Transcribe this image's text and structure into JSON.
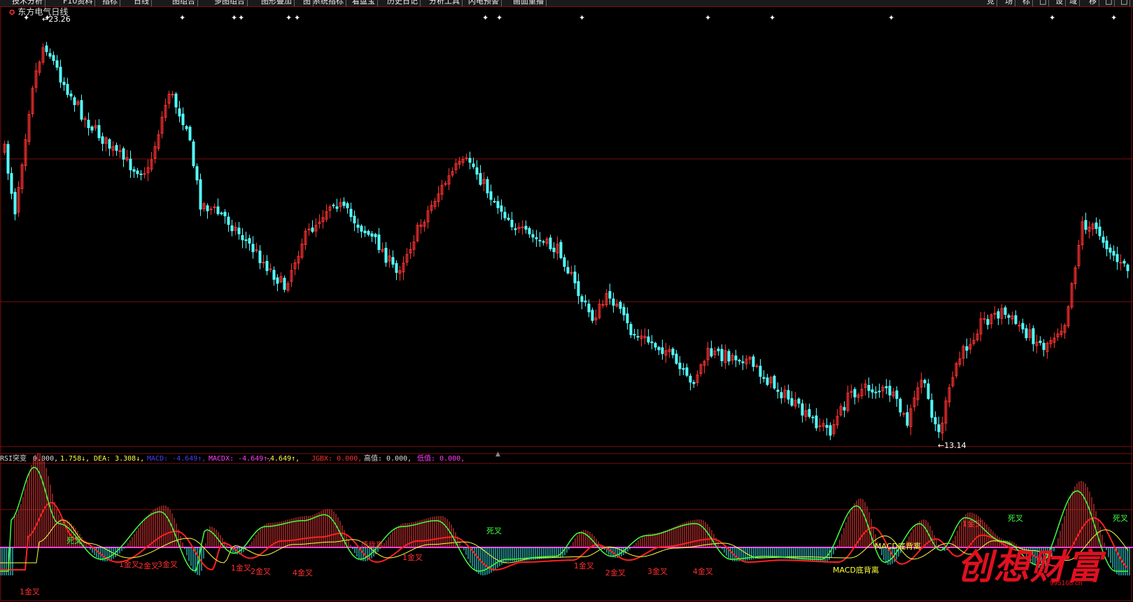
{
  "toolbar": [
    "技术分析",
    "F10资料",
    "指标",
    "日线",
    "图组合",
    "多图组合",
    "图形叠加",
    "图",
    "系统指标",
    "看盘宝",
    "历史日记",
    "分析工具",
    "闪电预警",
    "画面重播",
    "竞",
    "场",
    "标",
    "□",
    "设",
    "域",
    "移",
    "□",
    "□"
  ],
  "stock_title": "东方电气日线",
  "price_high_label": "23.26",
  "price_low_label": "13.14",
  "indicator": {
    "name": "RSI突变",
    "v0": "0.000,",
    "v1": "1.758↓,",
    "dea": "DEA: 3.308↓,",
    "macd": "MACD: -4.649↑,",
    "macdx": "MACDX: -4.649↑,",
    "v2": "-4.649↑,",
    "jgbx": "JGBX: 0.000,",
    "high": "高值: 0.000,",
    "low": "低值: 0.000,"
  },
  "signal_labels": [
    {
      "text": "1金叉",
      "color": "#ff3030"
    },
    {
      "text": "1金叉",
      "color": "#ff3030"
    },
    {
      "text": "2金叉",
      "color": "#ff3030"
    },
    {
      "text": "3金叉",
      "color": "#ff3030"
    },
    {
      "text": "1金叉",
      "color": "#ff3030"
    },
    {
      "text": "2金叉",
      "color": "#ff3030"
    },
    {
      "text": "4金叉",
      "color": "#ff3030"
    },
    {
      "text": "1金叉",
      "color": "#ff3030"
    },
    {
      "text": "1金叉",
      "color": "#ff3030"
    },
    {
      "text": "2金叉",
      "color": "#ff3030"
    },
    {
      "text": "3金叉",
      "color": "#ff3030"
    },
    {
      "text": "4金叉",
      "color": "#ff3030"
    },
    {
      "text": "1金叉",
      "color": "#ff3030"
    },
    {
      "text": "死叉",
      "color": "#40ff40"
    },
    {
      "text": "死叉",
      "color": "#40ff40"
    },
    {
      "text": "死叉",
      "color": "#40ff40"
    },
    {
      "text": "死叉",
      "color": "#40ff40"
    },
    {
      "text": "顶背离",
      "color": "#ff3030"
    },
    {
      "text": "MACD底背离",
      "color": "#ffff40"
    },
    {
      "text": "MACD底背离",
      "color": "#ffff40"
    }
  ],
  "watermark": "创想财富",
  "watermark_url": "995168.cn",
  "colors": {
    "up": "#ff3232",
    "down": "#54ffff",
    "grid": "#7a1010",
    "dif": "#ff2020",
    "dea": "#ffff40",
    "k": "#40ff40"
  }
}
